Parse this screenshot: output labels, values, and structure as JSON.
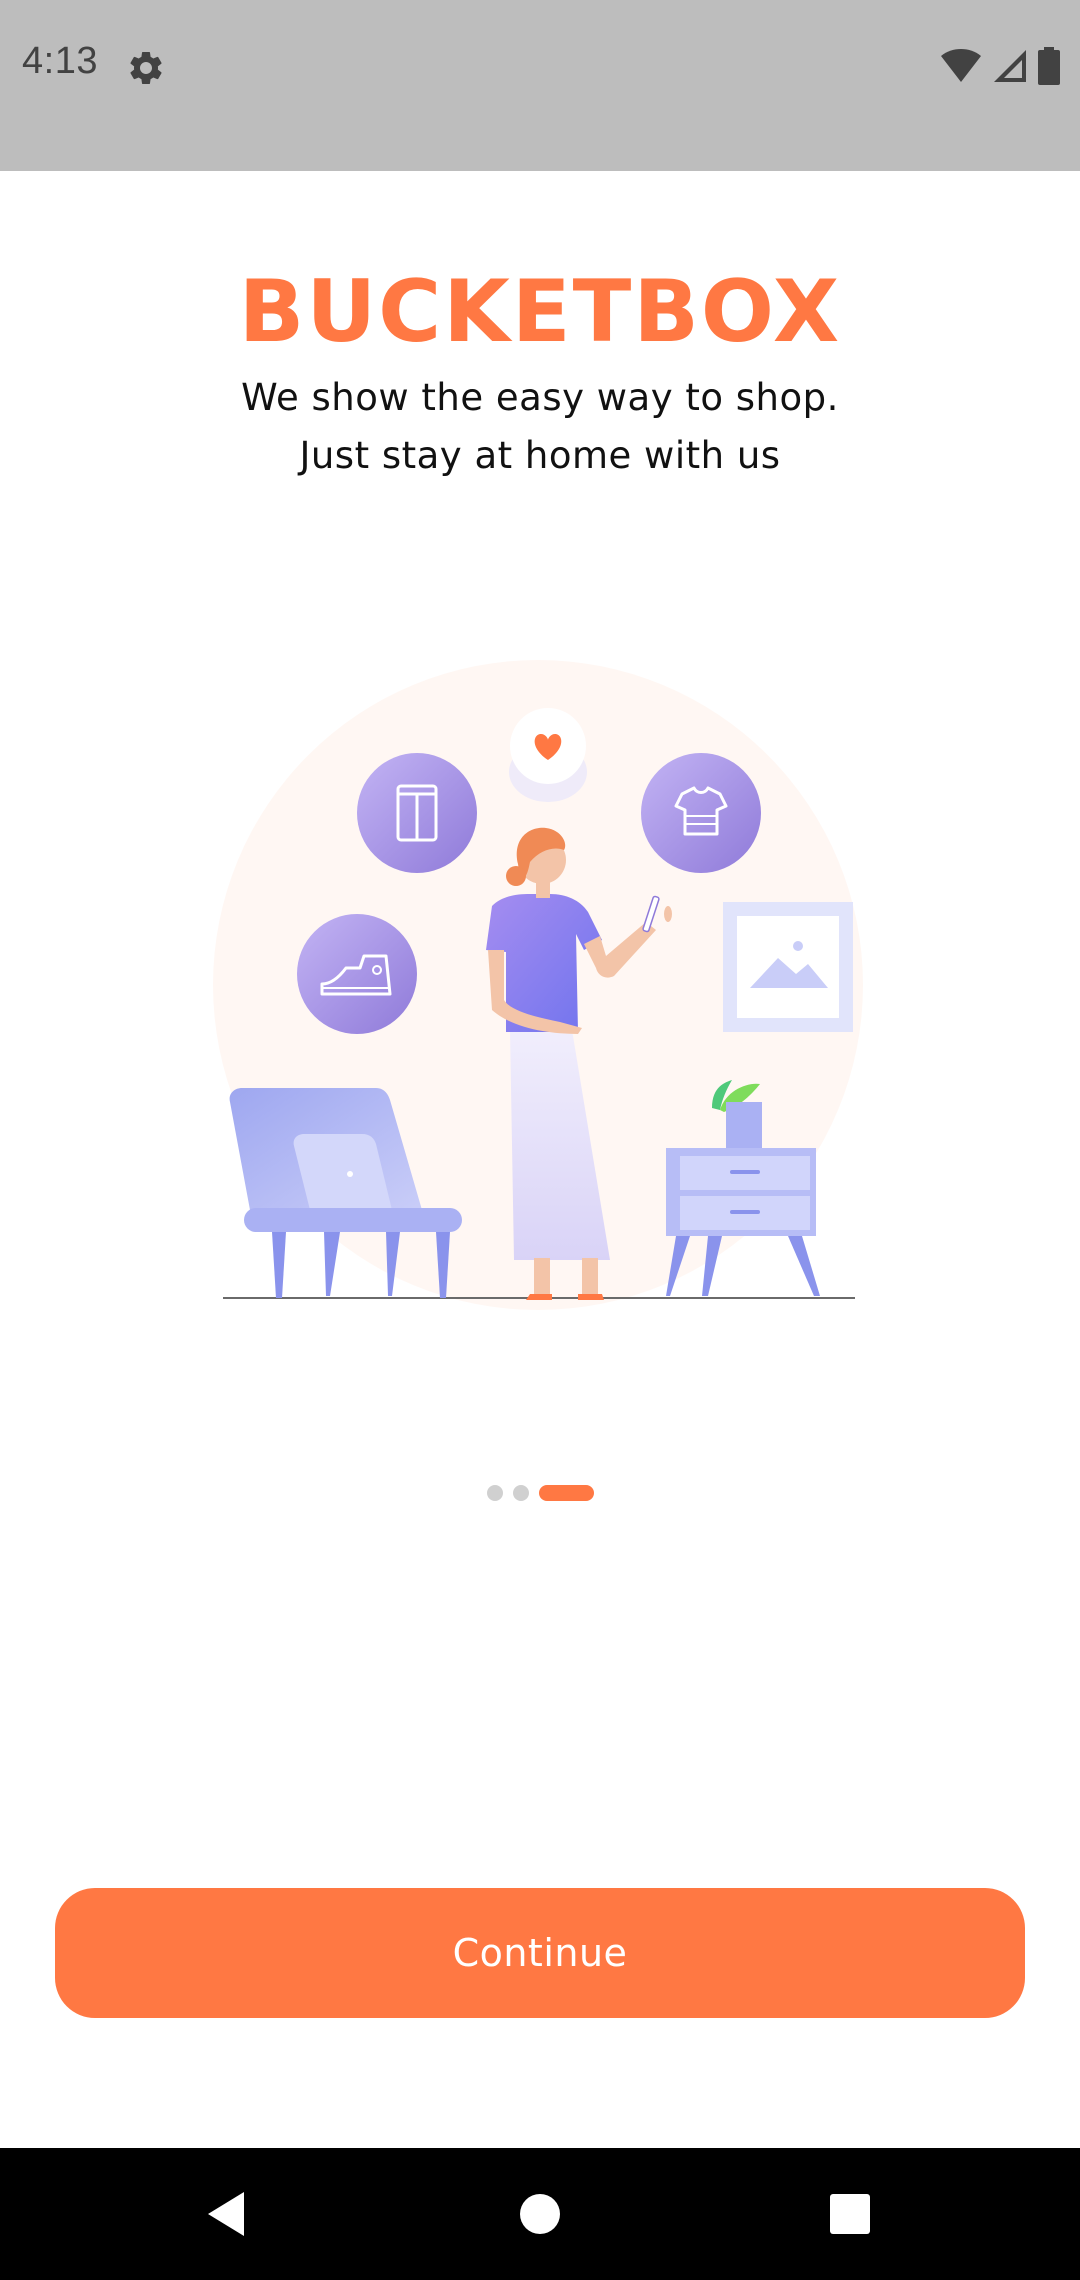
{
  "status_bar": {
    "time": "4:13",
    "icons": [
      "settings-gear-icon",
      "wifi-icon",
      "cell-signal-icon",
      "battery-icon"
    ]
  },
  "onboarding": {
    "brand": "BUCKETBOX",
    "tagline_line1": "We show the easy way to shop.",
    "tagline_line2": "Just stay at home with us",
    "illustration": "woman-shopping-on-phone-at-home-illustration",
    "page_indicator": {
      "total": 3,
      "current": 3
    },
    "continue_label": "Continue"
  },
  "navigation_bar": {
    "icons": [
      "back-icon",
      "home-icon",
      "recents-icon"
    ]
  },
  "colors": {
    "accent": "#ff7843",
    "status_bar_bg": "#bdbdbd",
    "nav_bar_bg": "#000000",
    "illustration_purple": "#9a86e8",
    "illustration_lavender": "#c4c8f5"
  }
}
